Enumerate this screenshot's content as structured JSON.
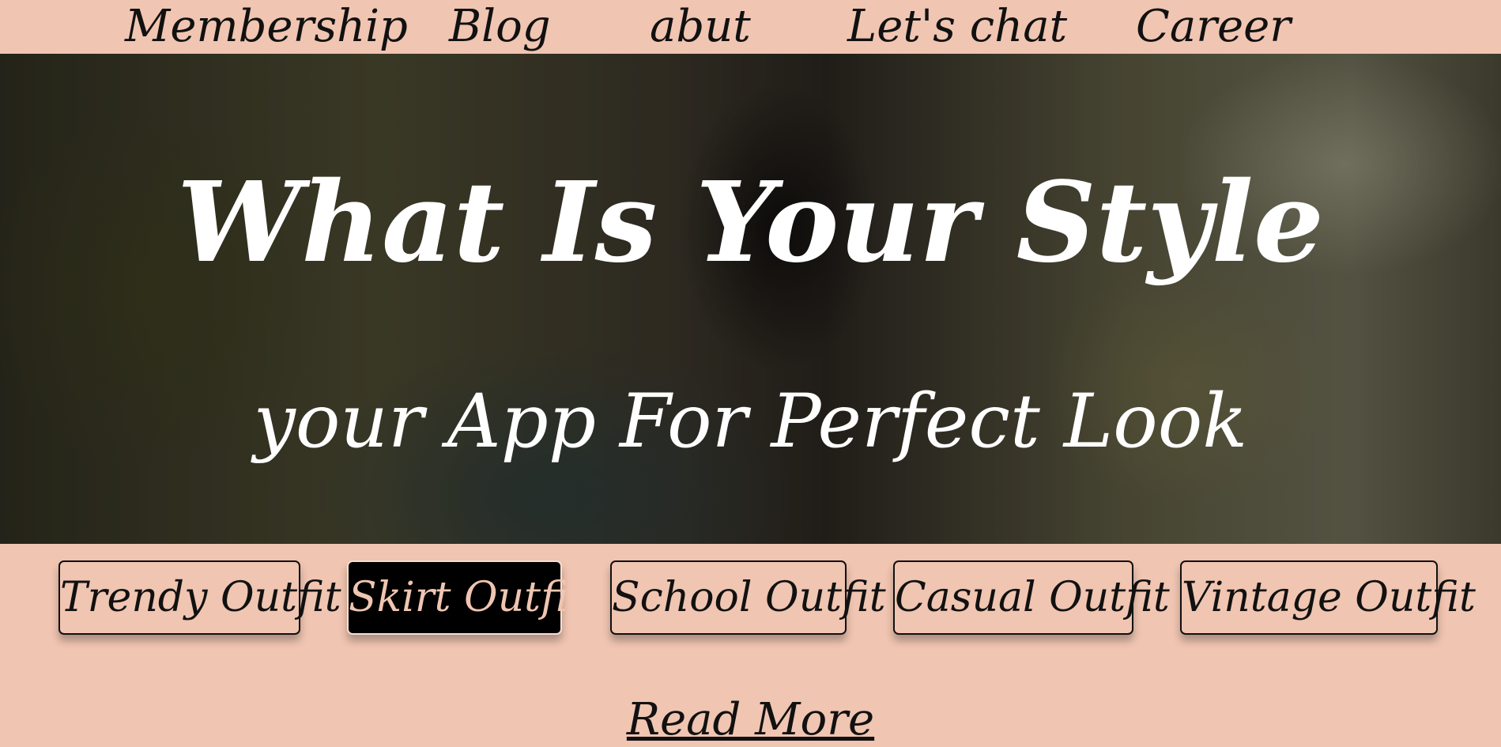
{
  "nav": {
    "items": [
      {
        "label": "Membership"
      },
      {
        "label": "Blog"
      },
      {
        "label": "abut"
      },
      {
        "label": "Let's chat"
      },
      {
        "label": "Career"
      }
    ]
  },
  "hero": {
    "title": "What Is Your Style",
    "subtitle": "your App For Perfect Look"
  },
  "outfits": {
    "buttons": [
      {
        "label": "Trendy Outfit"
      },
      {
        "label": "Skirt Outfit"
      },
      {
        "label": "School Outfit"
      },
      {
        "label": "Casual Outfit"
      },
      {
        "label": "Vintage Outfit"
      }
    ]
  },
  "read_more": {
    "label": "Read More"
  },
  "colors": {
    "background": "#f0c5b1",
    "text": "#111111",
    "active_button_bg": "#000000",
    "active_button_text": "#f0c5b1",
    "hero_text": "#ffffff"
  }
}
